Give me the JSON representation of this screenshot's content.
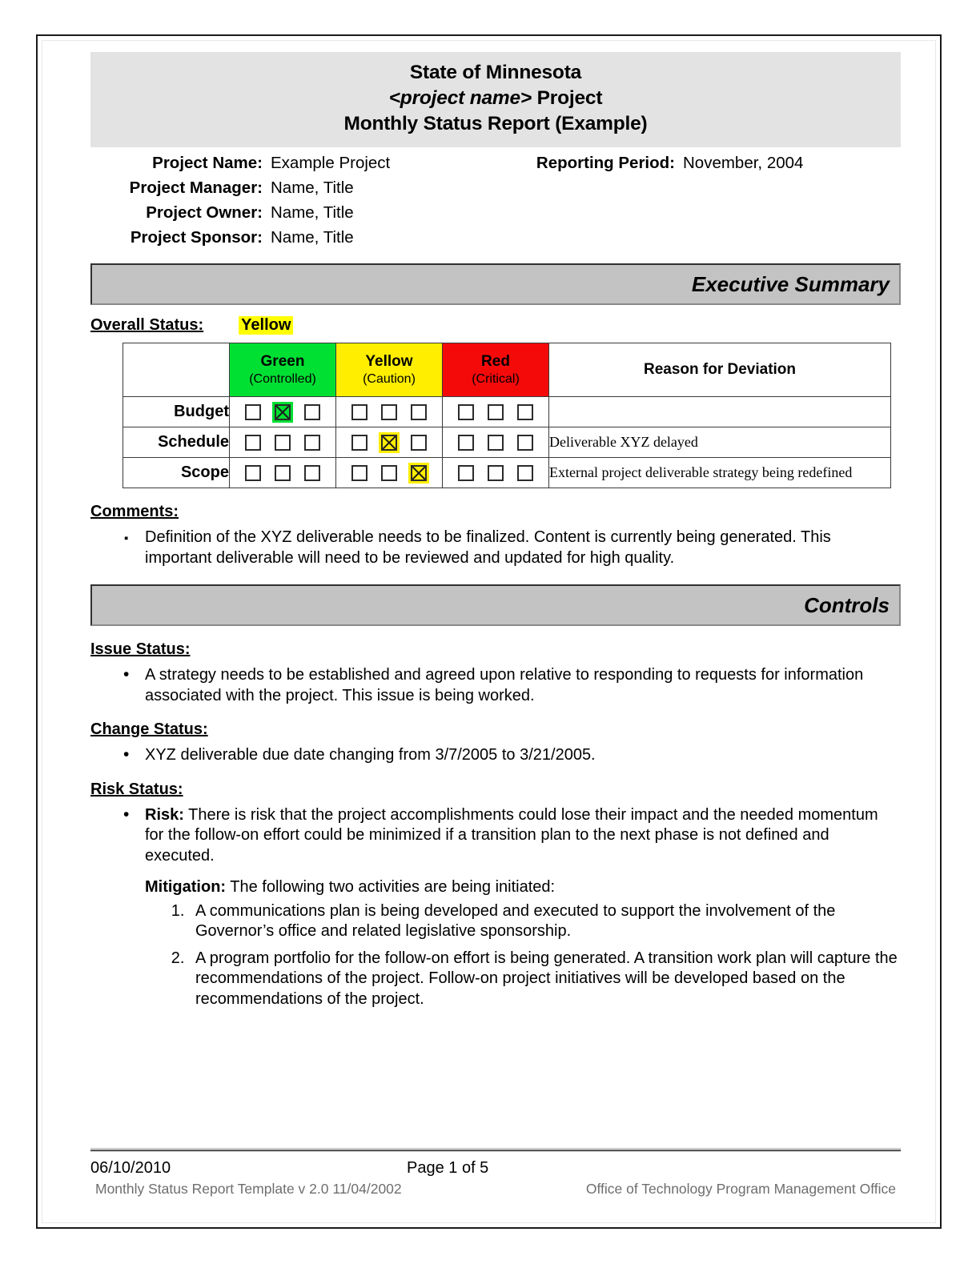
{
  "header": {
    "title_line1": "State of Minnesota",
    "title_line2_italic": "<project name>",
    "title_line2_rest": " Project",
    "title_line3": "Monthly Status Report (Example)"
  },
  "project_info": [
    {
      "label": "Project Name:",
      "value": "Example Project"
    },
    {
      "label": "Reporting Period:",
      "value": "November, 2004"
    },
    {
      "label": "Project Manager:",
      "value": "Name, Title"
    },
    {
      "label": "Project Owner:",
      "value": "Name, Title"
    },
    {
      "label": "Project Sponsor:",
      "value": "Name, Title"
    }
  ],
  "sections": {
    "executive_summary_banner": "Executive Summary",
    "controls_banner": "Controls"
  },
  "overall_status": {
    "label": "Overall Status:",
    "value": "Yellow",
    "highlight_color": "#ffff00"
  },
  "status_table": {
    "headers": {
      "blank": "",
      "green_title": "Green",
      "green_sub": "(Controlled)",
      "yellow_title": "Yellow",
      "yellow_sub": "(Caution)",
      "red_title": "Red",
      "red_sub": "(Critical)",
      "reason": "Reason for Deviation"
    },
    "colors": {
      "green": "#00e033",
      "yellow": "#ffee00",
      "red": "#f50a0a"
    },
    "rows": [
      {
        "label": "Budget",
        "green": [
          false,
          true,
          false
        ],
        "yellow": [
          false,
          false,
          false
        ],
        "red": [
          false,
          false,
          false
        ],
        "reason": ""
      },
      {
        "label": "Schedule",
        "green": [
          false,
          false,
          false
        ],
        "yellow": [
          false,
          true,
          false
        ],
        "red": [
          false,
          false,
          false
        ],
        "reason": "Deliverable XYZ delayed"
      },
      {
        "label": "Scope",
        "green": [
          false,
          false,
          false
        ],
        "yellow": [
          false,
          false,
          true
        ],
        "red": [
          false,
          false,
          false
        ],
        "reason": "External project deliverable strategy being redefined"
      }
    ]
  },
  "comments": {
    "heading": "Comments:",
    "items": [
      "Definition of the XYZ deliverable needs to be finalized.  Content is currently being generated.  This important deliverable will need to be reviewed and updated for high quality."
    ]
  },
  "issue_status": {
    "heading": "Issue Status:",
    "items": [
      "A strategy needs to be established and agreed upon relative to responding to requests for information associated with the project.  This issue is being worked."
    ]
  },
  "change_status": {
    "heading": "Change Status:",
    "items": [
      "XYZ deliverable due date changing from 3/7/2005 to 3/21/2005."
    ]
  },
  "risk_status": {
    "heading": "Risk Status:",
    "risk_label": "Risk:",
    "risk_text": " There is risk that the project accomplishments could lose their impact and the needed momentum for the follow-on effort could be minimized if a transition plan to the next phase is not defined and executed.",
    "mitigation_label": "Mitigation:",
    "mitigation_text": "  The following two activities are being initiated:",
    "mitigation_items": [
      "A communications plan is being developed and executed to support the involvement of the Governor’s office and related legislative sponsorship.",
      "A program portfolio for the follow-on effort is being generated. A transition work plan will capture the recommendations of the project. Follow-on project initiatives will be developed based on the recommendations of the project."
    ]
  },
  "footer": {
    "date": "06/10/2010",
    "page": "Page 1 of 5",
    "template": "Monthly Status Report Template  v 2.0  11/04/2002",
    "office": "Office of Technology Program Management Office"
  }
}
